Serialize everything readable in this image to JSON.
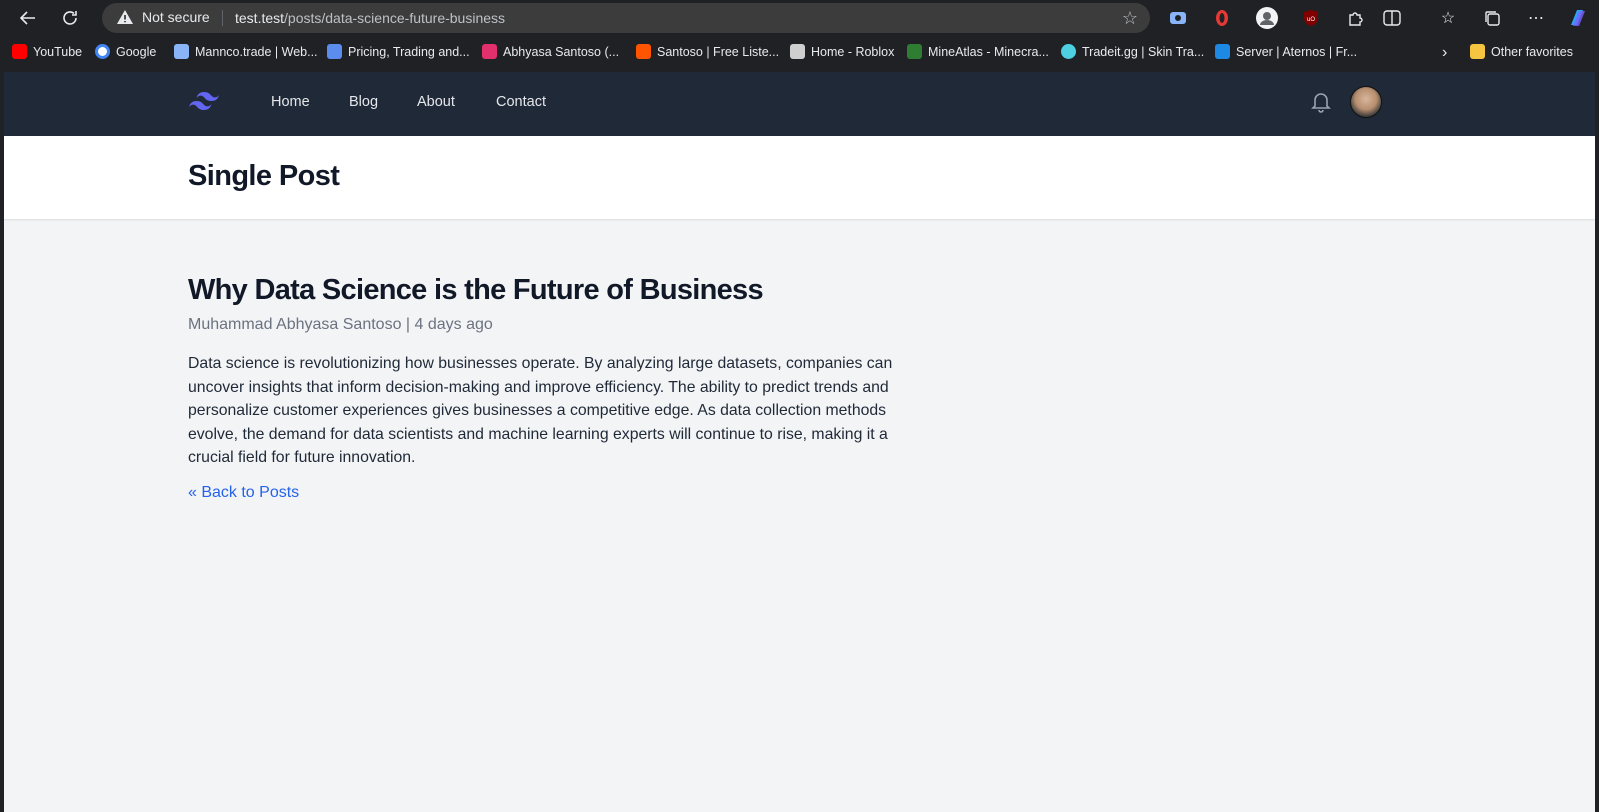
{
  "browser": {
    "security_label": "Not secure",
    "url_host": "test.test",
    "url_path": "/posts/data-science-future-business"
  },
  "bookmarks": [
    {
      "label": "YouTube",
      "color": "#ff0000"
    },
    {
      "label": "Google",
      "color": "#4285f4"
    },
    {
      "label": "Mannco.trade | Web...",
      "color": "#8ab4f8"
    },
    {
      "label": "Pricing, Trading and...",
      "color": "#5b8def"
    },
    {
      "label": "Abhyasa Santoso (...",
      "color": "#e1306c"
    },
    {
      "label": "Santoso | Free Liste...",
      "color": "#ff5500"
    },
    {
      "label": "Home - Roblox",
      "color": "#cfcfcf"
    },
    {
      "label": "MineAtlas - Minecra...",
      "color": "#2e7d32"
    },
    {
      "label": "Tradeit.gg | Skin Tra...",
      "color": "#4dd0e1"
    },
    {
      "label": "Server | Aternos | Fr...",
      "color": "#1e88e5"
    }
  ],
  "other_favorites": "Other favorites",
  "site": {
    "nav": [
      "Home",
      "Blog",
      "About",
      "Contact"
    ],
    "brand_color": "#6366f1"
  },
  "page": {
    "title": "Single Post"
  },
  "post": {
    "title": "Why Data Science is the Future of Business",
    "author": "Muhammad Abhyasa Santoso",
    "separator": "|",
    "date": "4 days ago",
    "body": "Data science is revolutionizing how businesses operate. By analyzing large datasets, companies can uncover insights that inform decision-making and improve efficiency. The ability to predict trends and personalize customer experiences gives businesses a competitive edge. As data collection methods evolve, the demand for data scientists and machine learning experts will continue to rise, making it a crucial field for future innovation.",
    "back_link": "« Back to Posts"
  },
  "icons": {
    "back": "back-arrow-icon",
    "refresh": "refresh-icon",
    "warning": "warning-icon",
    "favorite": "star-icon",
    "notifications": "bell-icon"
  }
}
